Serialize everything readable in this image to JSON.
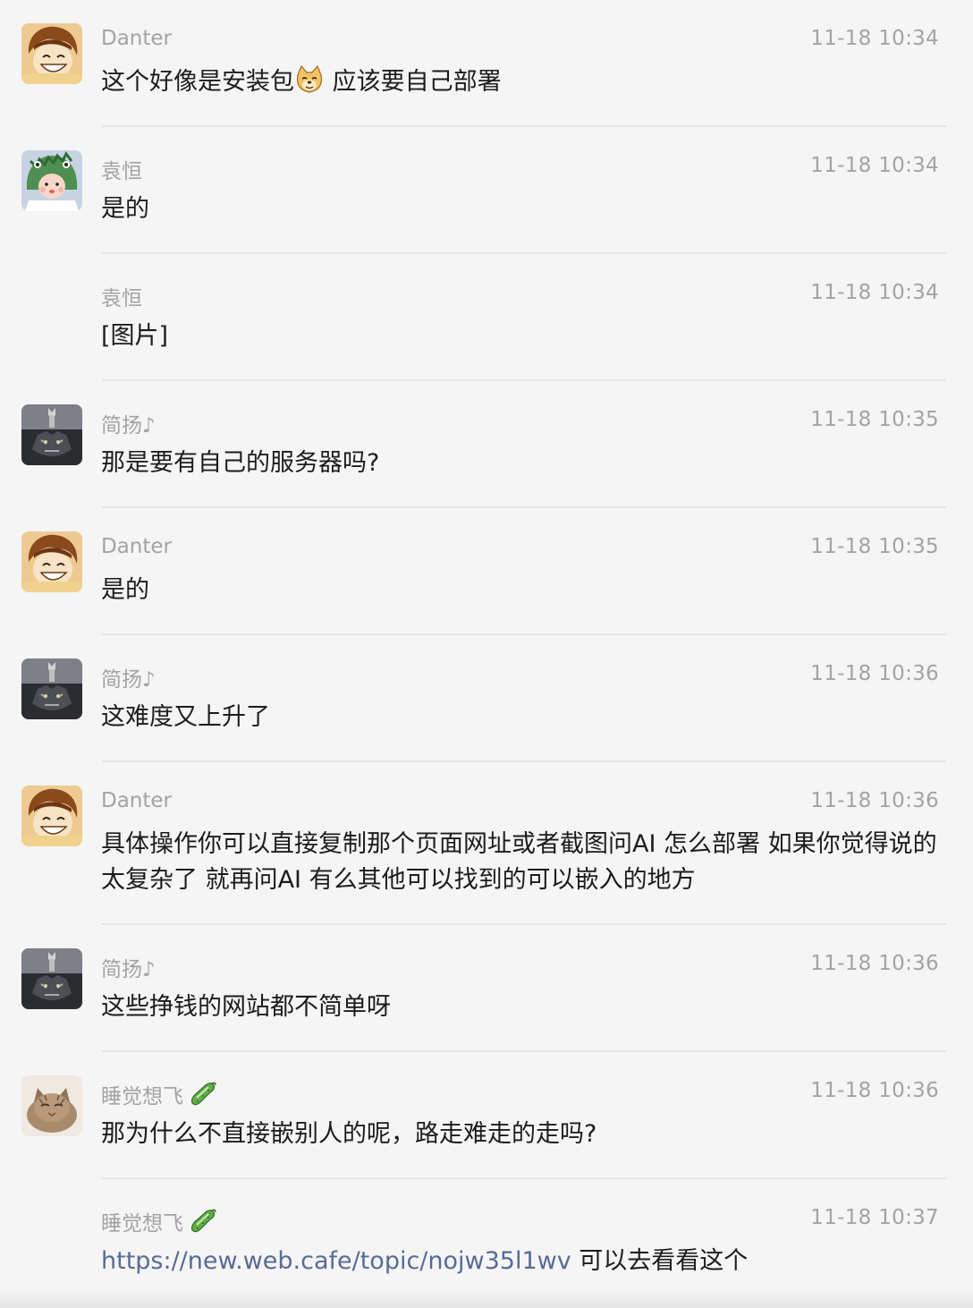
{
  "messages": [
    {
      "sender": "Danter",
      "time": "11-18 10:34",
      "text_a": "这个好像是安装包",
      "emoji": "doge-emoji",
      "text_b": " 应该要自己部署",
      "avatar": "anime-boy-avatar"
    },
    {
      "sender": "袁恒",
      "time": "11-18 10:34",
      "text": "是的",
      "avatar": "dinosaur-hat-avatar"
    },
    {
      "sender": "袁恒",
      "time": "11-18 10:34",
      "text": "[图片]",
      "avatar": "none"
    },
    {
      "sender": "简扬♪",
      "time": "11-18 10:35",
      "text": "那是要有自己的服务器吗?",
      "avatar": "cat-tiger-reflection-avatar"
    },
    {
      "sender": "Danter",
      "time": "11-18 10:35",
      "text": "是的",
      "avatar": "anime-boy-avatar"
    },
    {
      "sender": "简扬♪",
      "time": "11-18 10:36",
      "text": "这难度又上升了",
      "avatar": "cat-tiger-reflection-avatar"
    },
    {
      "sender": "Danter",
      "time": "11-18 10:36",
      "text": "具体操作你可以直接复制那个页面网址或者截图问AI 怎么部署 如果你觉得说的太复杂了  就再问AI 有么其他可以找到的可以嵌入的地方",
      "avatar": "anime-boy-avatar"
    },
    {
      "sender": "简扬♪",
      "time": "11-18 10:36",
      "text": "这些挣钱的网站都不简单呀",
      "avatar": "cat-tiger-reflection-avatar"
    },
    {
      "sender": "睡觉想飞",
      "time": "11-18 10:36",
      "text": "那为什么不直接嵌别人的呢，路走难走的走吗?",
      "avatar": "cat-photo-avatar",
      "badge": "cucumber-icon"
    },
    {
      "sender": "睡觉想飞",
      "time": "11-18 10:37",
      "link": "https://new.web.cafe/topic/nojw35l1wv",
      "text": " 可以去看看这个",
      "avatar": "none",
      "badge": "cucumber-icon"
    }
  ],
  "colors": {
    "background": "#f5f5f5",
    "meta_text": "#a3a3a3",
    "message_text": "#1c1c1c",
    "link": "#576b95",
    "divider": "#e5e5e5"
  }
}
